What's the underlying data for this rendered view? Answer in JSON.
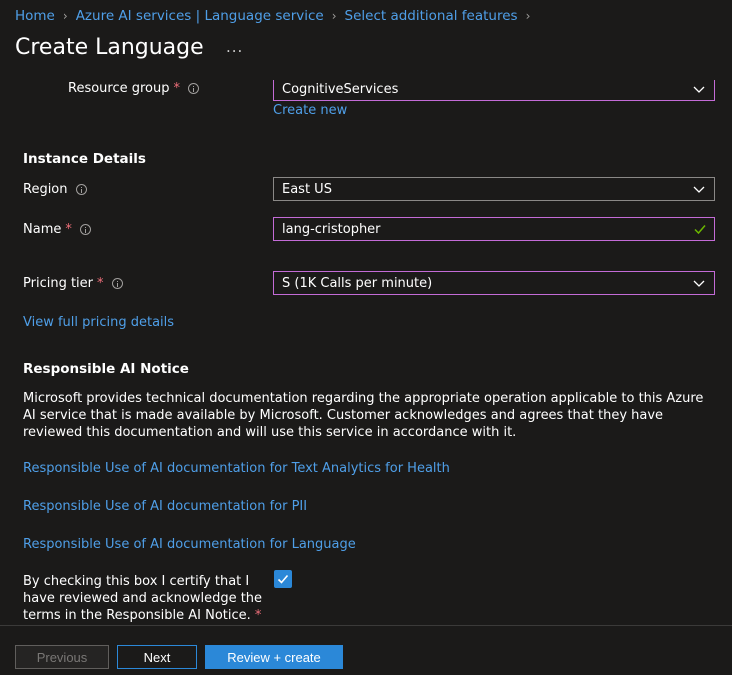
{
  "breadcrumb": {
    "items": [
      "Home",
      "Azure AI services | Language service",
      "Select additional features"
    ]
  },
  "page": {
    "title": "Create Language",
    "more_label": "..."
  },
  "project_details": {
    "resource_group_label": "Resource group",
    "resource_group_value": "CognitiveServices",
    "create_new_label": "Create new"
  },
  "instance_details": {
    "heading": "Instance Details",
    "region_label": "Region",
    "region_value": "East US",
    "name_label": "Name",
    "name_value": "lang-cristopher",
    "pricing_label": "Pricing tier",
    "pricing_value": "S (1K Calls per minute)",
    "pricing_link": "View full pricing details"
  },
  "responsible_ai": {
    "heading": "Responsible AI Notice",
    "notice": "Microsoft provides technical documentation regarding the appropriate operation applicable to this Azure AI service that is made available by Microsoft. Customer acknowledges and agrees that they have reviewed this documentation and will use this service in accordance with it.",
    "links": [
      "Responsible Use of AI documentation for Text Analytics for Health",
      "Responsible Use of AI documentation for PII",
      "Responsible Use of AI documentation for Language"
    ],
    "certify_text": "By checking this box I certify that I have reviewed and acknowledge the terms in the Responsible AI Notice.",
    "certify_checked": true
  },
  "footer": {
    "previous_label": "Previous",
    "next_label": "Next",
    "review_label": "Review + create"
  },
  "colors": {
    "background": "#1b1a19",
    "link": "#4f9fe8",
    "primary": "#2b88d8",
    "required": "#f1707b",
    "valid_border": "#c36bd6",
    "valid_check": "#6bb700"
  },
  "icons": [
    "chevron-right-icon",
    "info-icon",
    "chevron-down-icon",
    "checkmark-icon"
  ]
}
